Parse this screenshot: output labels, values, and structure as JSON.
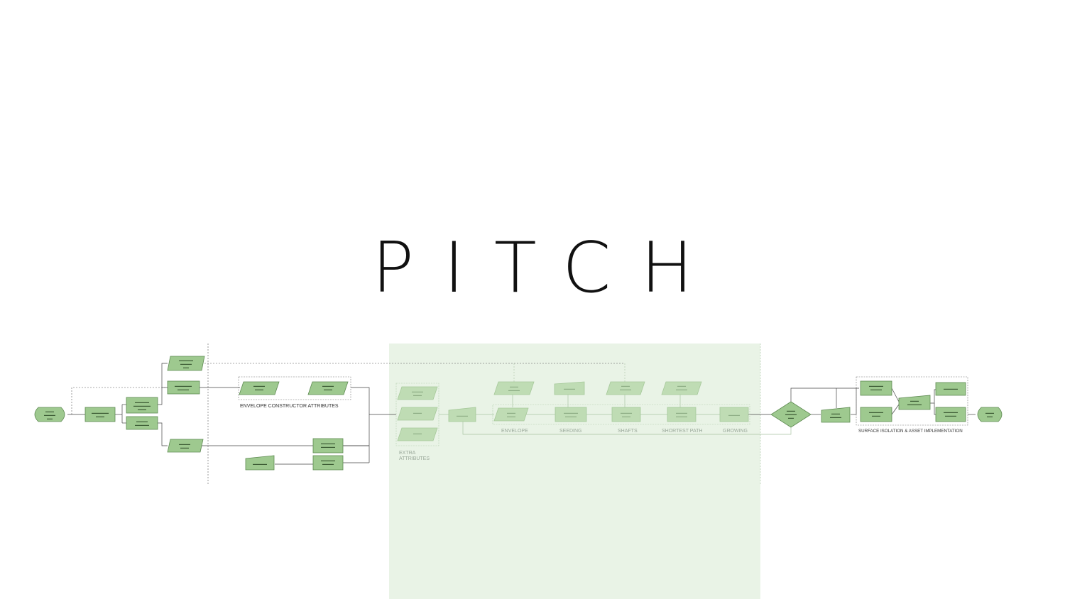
{
  "title": "PITCH",
  "labels": {
    "envelope_constructor": "ENVELOPE CONSTRUCTOR ATTRIBUTES",
    "extra_attributes_1": "EXTRA",
    "extra_attributes_2": "ATTRIBUTES",
    "envelope": "ENVELOPE",
    "seeding": "SEEDING",
    "shafts": "SHAFTS",
    "shortest_path": "SHORTEST PATH",
    "growing": "GROWING",
    "surface_isolation": "SURFACE ISOLATION & ASSET IMPLEMENTATION"
  },
  "colors": {
    "node_fill": "#9ec98f",
    "node_stroke": "#5e8a52",
    "highlight": "#e9f3e6"
  }
}
